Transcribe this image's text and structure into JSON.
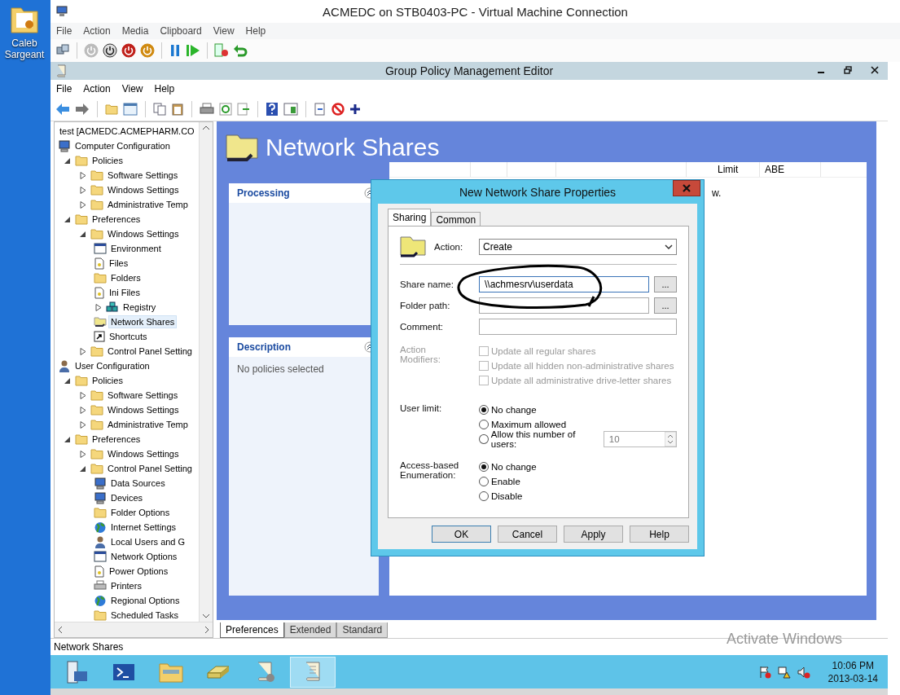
{
  "desktop_icons": [
    {
      "label": "Caleb Sargeant"
    }
  ],
  "vm_window": {
    "title": "ACMEDC on STB0403-PC - Virtual Machine Connection",
    "menu": [
      "File",
      "Action",
      "Media",
      "Clipboard",
      "View",
      "Help"
    ]
  },
  "gpme_window": {
    "title": "Group Policy Management Editor",
    "menu": [
      "File",
      "Action",
      "View",
      "Help"
    ]
  },
  "tree": {
    "items": [
      {
        "label": "test [ACMEDC.ACMEPHARM.CO",
        "selected": false
      },
      {
        "label": "Computer Configuration",
        "kind": "computer",
        "selected": false,
        "children": [
          {
            "label": "Policies",
            "kind": "folder",
            "expanded": true,
            "selected": false,
            "children": [
              {
                "label": "Software Settings",
                "kind": "folder",
                "expanded": false,
                "selected": false
              },
              {
                "label": "Windows Settings",
                "kind": "folder",
                "expanded": false,
                "selected": false
              },
              {
                "label": "Administrative Temp",
                "kind": "folder",
                "expanded": false,
                "selected": false
              }
            ]
          },
          {
            "label": "Preferences",
            "kind": "folder",
            "expanded": true,
            "selected": false,
            "children": [
              {
                "label": "Windows Settings",
                "kind": "folder",
                "expanded": true,
                "selected": false,
                "children": [
                  {
                    "label": "Environment",
                    "kind": "window",
                    "selected": false
                  },
                  {
                    "label": "Files",
                    "kind": "document",
                    "selected": false
                  },
                  {
                    "label": "Folders",
                    "kind": "folder",
                    "selected": false
                  },
                  {
                    "label": "Ini Files",
                    "kind": "document",
                    "selected": false
                  },
                  {
                    "label": "Registry",
                    "kind": "cubes",
                    "expanded": false,
                    "selected": false
                  },
                  {
                    "label": "Network Shares",
                    "kind": "share",
                    "selected": true
                  },
                  {
                    "label": "Shortcuts",
                    "kind": "shortcut",
                    "selected": false
                  }
                ]
              },
              {
                "label": "Control Panel Setting",
                "kind": "folder",
                "expanded": false,
                "selected": false
              }
            ]
          }
        ]
      },
      {
        "label": "User Configuration",
        "kind": "person",
        "selected": false,
        "children": [
          {
            "label": "Policies",
            "kind": "folder",
            "expanded": true,
            "selected": false,
            "children": [
              {
                "label": "Software Settings",
                "kind": "folder",
                "expanded": false,
                "selected": false
              },
              {
                "label": "Windows Settings",
                "kind": "folder",
                "expanded": false,
                "selected": false
              },
              {
                "label": "Administrative Temp",
                "kind": "folder",
                "expanded": false,
                "selected": false
              }
            ]
          },
          {
            "label": "Preferences",
            "kind": "folder",
            "expanded": true,
            "selected": false,
            "children": [
              {
                "label": "Windows Settings",
                "kind": "folder",
                "expanded": false,
                "selected": false
              },
              {
                "label": "Control Panel Setting",
                "kind": "folder",
                "expanded": true,
                "selected": false,
                "children": [
                  {
                    "label": "Data Sources",
                    "kind": "computer",
                    "selected": false
                  },
                  {
                    "label": "Devices",
                    "kind": "computer",
                    "selected": false
                  },
                  {
                    "label": "Folder Options",
                    "kind": "folder",
                    "selected": false
                  },
                  {
                    "label": "Internet Settings",
                    "kind": "globe",
                    "selected": false
                  },
                  {
                    "label": "Local Users and G",
                    "kind": "person",
                    "selected": false
                  },
                  {
                    "label": "Network Options",
                    "kind": "window",
                    "selected": false
                  },
                  {
                    "label": "Power Options",
                    "kind": "document",
                    "selected": false
                  },
                  {
                    "label": "Printers",
                    "kind": "printer",
                    "selected": false
                  },
                  {
                    "label": "Regional Options",
                    "kind": "globe",
                    "selected": false
                  },
                  {
                    "label": "Scheduled Tasks",
                    "kind": "folder",
                    "selected": false
                  }
                ]
              }
            ]
          }
        ]
      }
    ]
  },
  "pane": {
    "title": "Network Shares",
    "processing": {
      "title": "Processing"
    },
    "description": {
      "title": "Description",
      "text": "No policies selected"
    },
    "list_view": {
      "columns": [
        "Limit",
        "ABE"
      ],
      "empty_text": "w."
    }
  },
  "view_tabs": [
    {
      "label": "Preferences",
      "selected": true
    },
    {
      "label": "Extended",
      "selected": false
    },
    {
      "label": "Standard",
      "selected": false
    }
  ],
  "status_bar": "Network Shares",
  "dialog": {
    "title": "New Network Share Properties",
    "tabs": [
      {
        "label": "Sharing",
        "selected": true
      },
      {
        "label": "Common",
        "selected": false
      }
    ],
    "action": {
      "label": "Action:",
      "value": "Create"
    },
    "fields": [
      {
        "label": "Share name:",
        "value": "\\\\achmesrv\\userdata",
        "browse": "...",
        "focused": true
      },
      {
        "label": "Folder path:",
        "browse": "...",
        "focused": false
      },
      {
        "label": "Comment:",
        "focused": false
      }
    ],
    "modifiers": {
      "label": "Action Modifiers:",
      "disabled": true,
      "options": [
        {
          "label": "Update all regular shares",
          "checked": false
        },
        {
          "label": "Update all hidden non-administrative shares",
          "checked": false
        },
        {
          "label": "Update all administrative drive-letter shares",
          "checked": false
        }
      ]
    },
    "user_limit": {
      "label": "User limit:",
      "options": [
        {
          "label": "No change",
          "selected": true
        },
        {
          "label": "Maximum allowed",
          "selected": false
        },
        {
          "label": "Allow this number of users:",
          "selected": false
        }
      ],
      "count": "10"
    },
    "abe": {
      "label": "Access-based Enumeration:",
      "options": [
        {
          "label": "No change",
          "selected": true
        },
        {
          "label": "Enable",
          "selected": false
        },
        {
          "label": "Disable",
          "selected": false
        }
      ]
    },
    "buttons": [
      {
        "label": "OK",
        "default": true
      },
      {
        "label": "Cancel",
        "default": false
      },
      {
        "label": "Apply",
        "default": false
      },
      {
        "label": "Help",
        "default": false
      }
    ]
  },
  "taskbar": {
    "buttons": [
      {
        "kind": "server",
        "selected": false
      },
      {
        "kind": "shell",
        "selected": false
      },
      {
        "kind": "explorer",
        "selected": false
      },
      {
        "kind": "drive",
        "selected": false
      },
      {
        "kind": "scroll-gear",
        "selected": false
      },
      {
        "kind": "scroll",
        "selected": true
      }
    ],
    "time": "10:06 PM",
    "date": "2013-03-14"
  },
  "activation_notice": "Activate Windows"
}
